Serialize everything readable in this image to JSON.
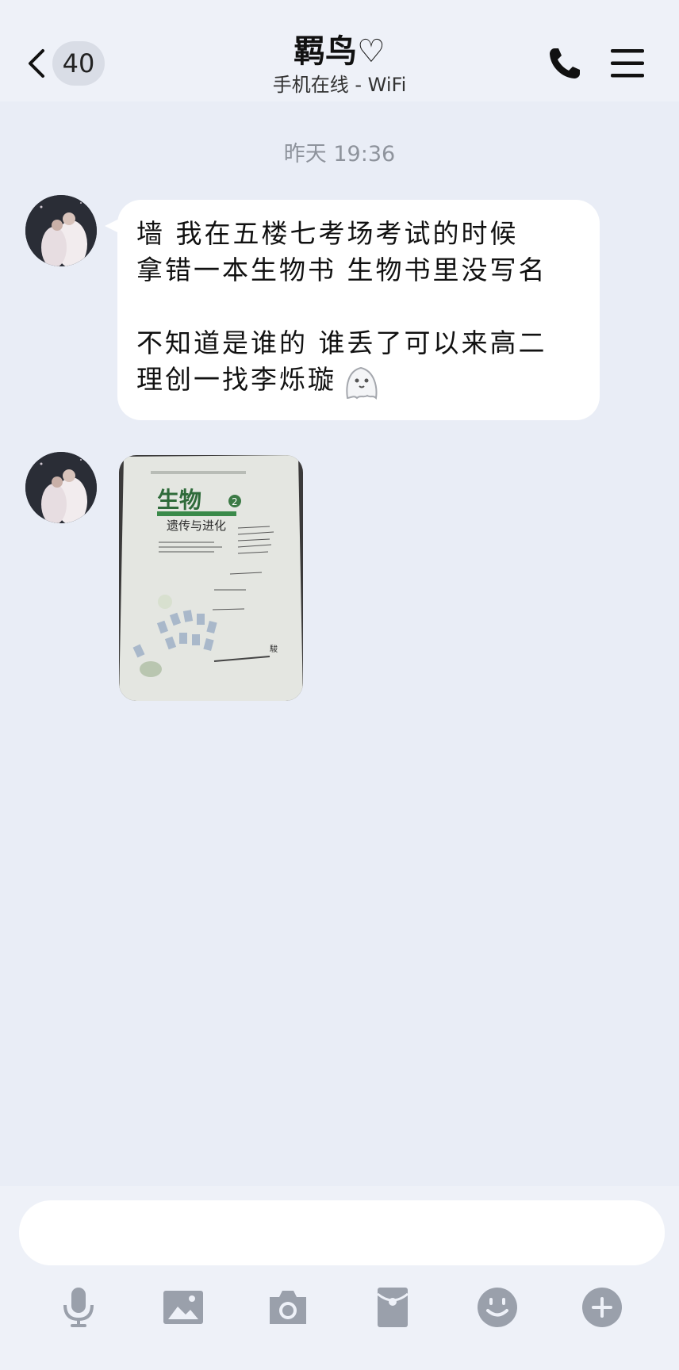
{
  "header": {
    "back_badge": "40",
    "title": "羁鸟♡",
    "subtitle": "手机在线 - WiFi",
    "icons": [
      "back-chevron-icon",
      "phone-icon",
      "menu-icon"
    ]
  },
  "conversation": {
    "timestamp": "昨天 19:36",
    "message": {
      "lines": [
        "墙  我在五楼七考场考试的时候",
        "拿错一本生物书 生物书里没写名",
        "",
        "不知道是谁的 谁丢了可以来高二",
        "理创一找李烁璇"
      ],
      "emoji": "ghost-emoji-icon"
    },
    "photo": {
      "book_title": "生物",
      "book_volume": "2",
      "book_subtitle": "遗传与进化"
    }
  },
  "input": {
    "placeholder": ""
  },
  "toolbar": {
    "icons": [
      "microphone-icon",
      "image-icon",
      "camera-icon",
      "red-packet-icon",
      "emoji-icon",
      "plus-icon"
    ]
  },
  "colors": {
    "background": "#e9edf6",
    "header": "#eef1f8",
    "bubble": "#ffffff",
    "icon_gray": "#9aa0ab",
    "timestamp": "#8e939c"
  }
}
